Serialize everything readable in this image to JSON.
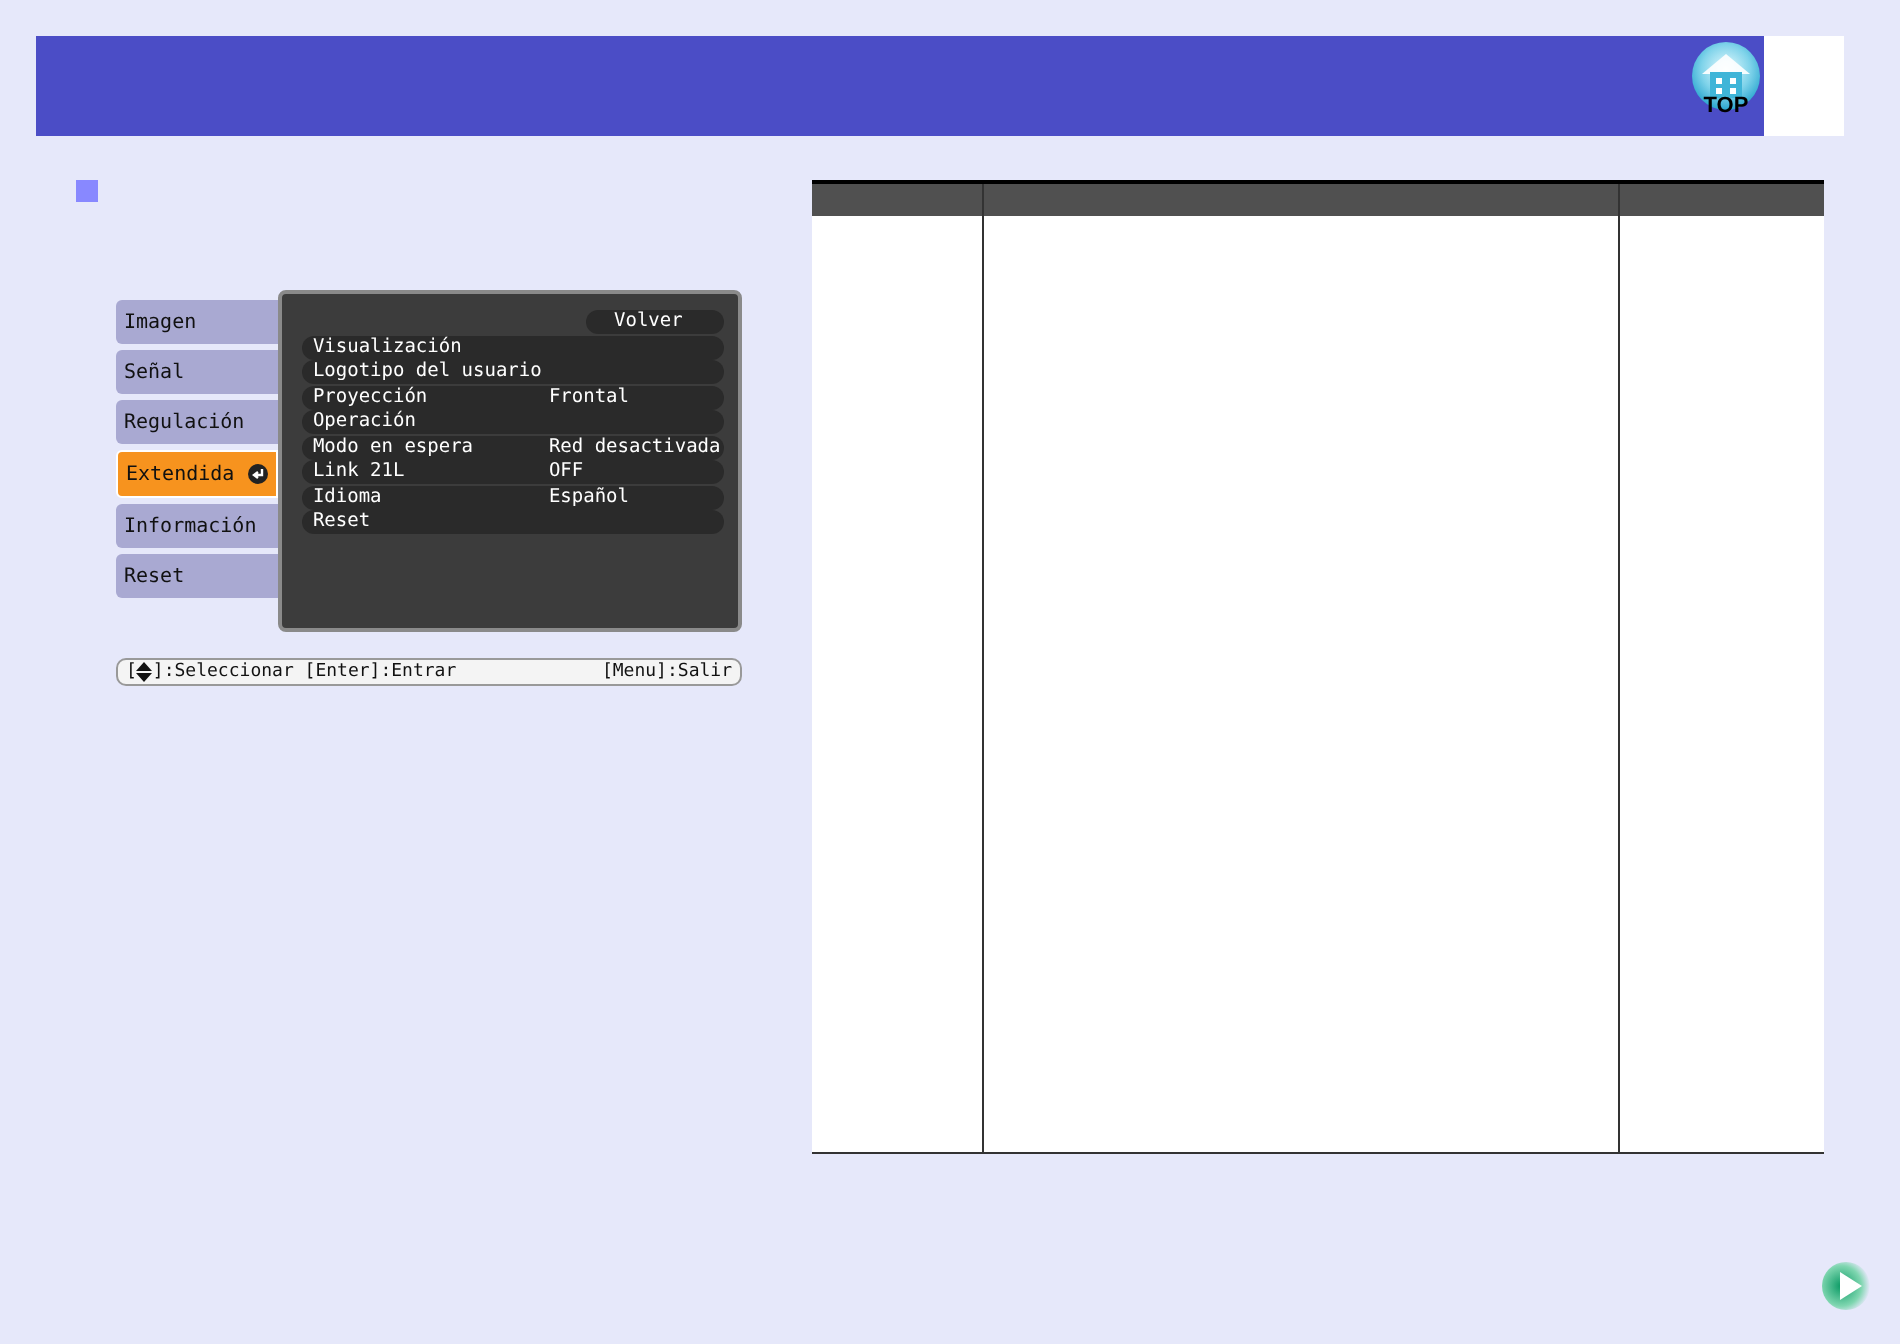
{
  "header": {
    "top_button": "TOP"
  },
  "menu": {
    "tabs": [
      {
        "label": "Imagen",
        "selected": false
      },
      {
        "label": "Señal",
        "selected": false
      },
      {
        "label": "Regulación",
        "selected": false
      },
      {
        "label": "Extendida",
        "selected": true
      },
      {
        "label": "Información",
        "selected": false
      },
      {
        "label": "Reset",
        "selected": false
      }
    ],
    "back": "Volver",
    "items": [
      {
        "label": "Visualización"
      },
      {
        "label": "Logotipo del usuario"
      },
      {
        "label": "Proyección",
        "value": "Frontal"
      },
      {
        "label": "Operación"
      },
      {
        "label": "Modo en espera",
        "value": "Red desactivada"
      },
      {
        "label": "Link 21L",
        "value": "OFF"
      },
      {
        "label": "Idioma",
        "value": "Español"
      },
      {
        "label": "Reset"
      }
    ],
    "footer": {
      "select_open": "[",
      "select_rest": "]:Seleccionar [Enter]:Entrar",
      "exit": "[Menu]:Salir"
    }
  }
}
